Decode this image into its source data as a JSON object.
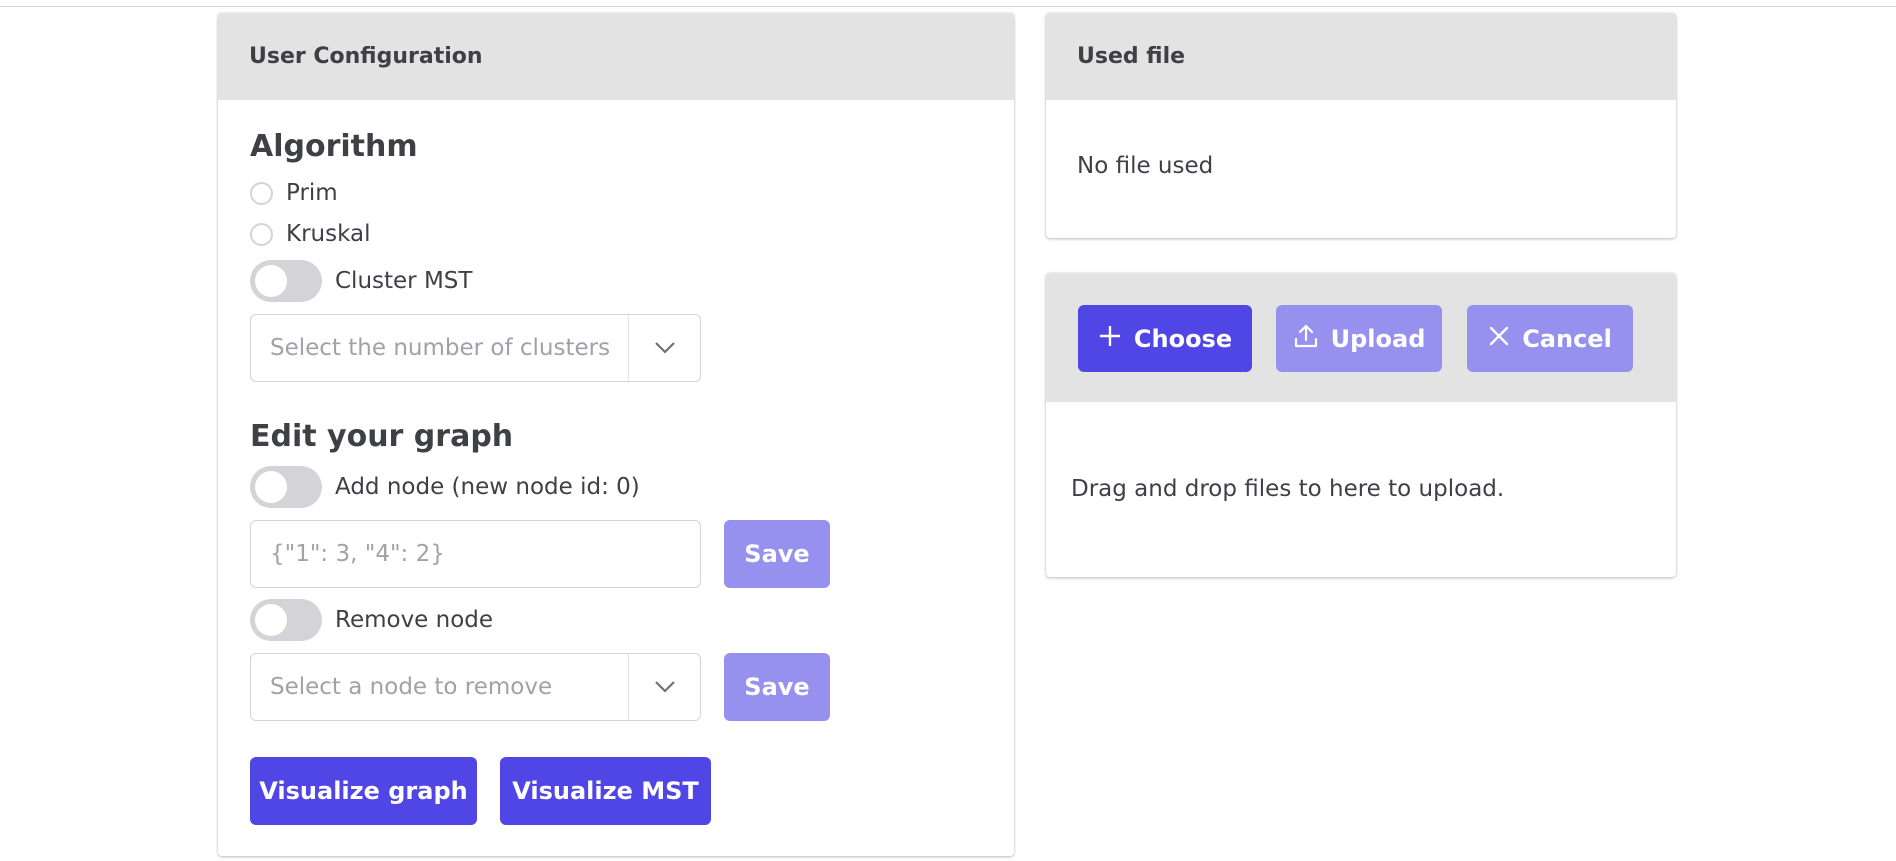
{
  "config": {
    "header": "User Configuration",
    "algorithm": {
      "title": "Algorithm",
      "options": [
        "Prim",
        "Kruskal"
      ],
      "cluster_toggle_label": "Cluster MST",
      "cluster_select_placeholder": "Select the number of clusters"
    },
    "edit": {
      "title": "Edit your graph",
      "add_toggle_label": "Add node (new node id: 0)",
      "add_input_placeholder": "{\"1\": 3, \"4\": 2}",
      "add_save_label": "Save",
      "remove_toggle_label": "Remove node",
      "remove_select_placeholder": "Select a node to remove",
      "remove_save_label": "Save"
    },
    "visualize_graph_label": "Visualize graph",
    "visualize_mst_label": "Visualize MST"
  },
  "used_file": {
    "header": "Used file",
    "status": "No file used"
  },
  "upload": {
    "choose_label": "Choose",
    "upload_label": "Upload",
    "cancel_label": "Cancel",
    "dropzone_text": "Drag and drop files to here to upload."
  },
  "colors": {
    "primary": "#4f46e5",
    "primary_muted": "#9691ee",
    "header_bg": "#e3e3e3"
  },
  "icons": {
    "choose": "plus-icon",
    "upload": "upload-icon",
    "cancel": "x-icon",
    "dropdown": "chevron-down-icon"
  }
}
